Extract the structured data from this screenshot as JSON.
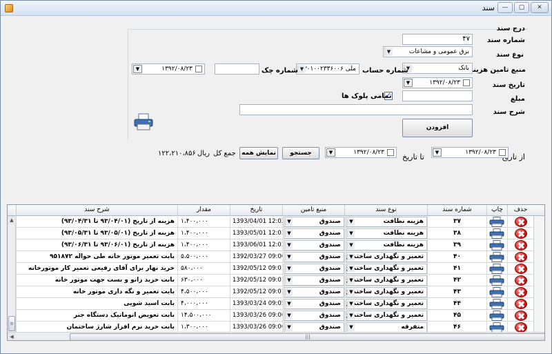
{
  "window": {
    "title": "سند"
  },
  "form": {
    "section_label": "درج سند",
    "doc_number_label": "شماره سند",
    "doc_number_value": "۴۷",
    "doc_type_label": "نوع سند",
    "doc_type_value": "برق عمومی و مشاعات",
    "funding_label": "منبع تامین هزینه",
    "funding_value": "بانک",
    "account_label": "شماره حساب",
    "account_value": "ملی ۰۳۰۱۰۰۲۳۳۶۰۰۶",
    "check_label": "شماره چک",
    "check_value": "",
    "doc_date_label": "تاریخ سند",
    "doc_date_value": "۱۳۹۲/۰۸/۲۳",
    "check_date_value": "۱۳۹۲/۰۸/۲۳",
    "amount_label": "مبلغ",
    "amount_value": "",
    "all_plaques_label": "تمامی پلوک ها",
    "all_plaques_checked": true,
    "description_label": "شرح سند",
    "description_value": "",
    "add_button": "افزودن"
  },
  "filter": {
    "from_date_label": "از تاریخ",
    "from_date_value": "۱۳۹۲/۰۸/۲۳",
    "to_date_label": "تا تاریخ",
    "to_date_value": "۱۳۹۲/۰۸/۲۳",
    "search_button": "جستجو",
    "show_all_button": "نمایش همه",
    "total_label": "جمع کل",
    "total_unit": "ریال",
    "total_value": "۱۲۲،۲۱۰،۸۵۶"
  },
  "grid": {
    "columns": [
      "حذف",
      "چاپ",
      "شماره سند",
      "نوع سند",
      "منبع تامین",
      "تاریخ",
      "مقدار",
      "شرح سند"
    ],
    "rows": [
      {
        "no": "۳۷",
        "type": "هزینه نظافت",
        "source": "صندوق",
        "date": "1393/04/01 12:02",
        "amount": "۱،۴۰۰،۰۰۰",
        "desc": "هزینه از تاریخ (۹۳/۰۴/۰۱ تا ۹۳/۰۴/۳۱)"
      },
      {
        "no": "۳۸",
        "type": "هزینه نظافت",
        "source": "صندوق",
        "date": "1393/05/01 12:03",
        "amount": "۱،۴۰۰،۰۰۰",
        "desc": "هزینه از تاریخ (۹۳/۰۵/۰۱ تا ۹۳/۰۵/۳۱)"
      },
      {
        "no": "۳۹",
        "type": "هزینه نظافت",
        "source": "صندوق",
        "date": "1393/06/01 12:03",
        "amount": "۱،۴۰۰،۰۰۰",
        "desc": "هزینه از تاریخ (۹۳/۰۶/۰۱ تا ۹۳/۰۶/۳۱)"
      },
      {
        "no": "۴۰",
        "type": "تعمیر و نگهداری ساختمان",
        "source": "صندوق",
        "date": "1392/03/27 09:00",
        "amount": "۵،۵۰۰،۰۰۰",
        "desc": "بابت تعمیر موتور خانه طی حواله ۹۵۱۸۷۲"
      },
      {
        "no": "۴۱",
        "type": "تعمیر و نگهداری ساختمان",
        "source": "صندوق",
        "date": "1392/05/12 09:01",
        "amount": "۵۸۰،۰۰۰",
        "desc": "خرید نهار برای آقای رفیعی تعمیر کار موتورخانه"
      },
      {
        "no": "۴۲",
        "type": "تعمیر و نگهداری ساختمان",
        "source": "صندوق",
        "date": "1392/05/12 09:01",
        "amount": "۶۳۰،۰۰۰",
        "desc": "بابت خرید زانو و بست جهت موتور خانه"
      },
      {
        "no": "۴۳",
        "type": "تعمیر و نگهداری ساختمان",
        "source": "صندوق",
        "date": "1392/05/12 09:01",
        "amount": "۴،۵۰۰،۰۰۰",
        "desc": "بابت تعمیر و نگه داری موتور خانه"
      },
      {
        "no": "۴۴",
        "type": "تعمیر و نگهداری ساختمان",
        "source": "صندوق",
        "date": "1393/03/24 09:05",
        "amount": "۴،۰۰۰،۰۰۰",
        "desc": "بابت اسید شویی"
      },
      {
        "no": "۴۵",
        "type": "تعمیر و نگهداری ساختمان",
        "source": "صندوق",
        "date": "1393/03/26 09:06",
        "amount": "۱۴،۵۰۰،۰۰۰",
        "desc": "بابت تعویض اتوماتیک دستگاه جنر"
      },
      {
        "no": "۴۶",
        "type": "متفرقه",
        "source": "صندوق",
        "date": "1393/03/26 09:06",
        "amount": "۱،۳۰۰،۰۰۰",
        "desc": "بابت خرید نرم افزار شارژ ساختمان"
      }
    ]
  }
}
